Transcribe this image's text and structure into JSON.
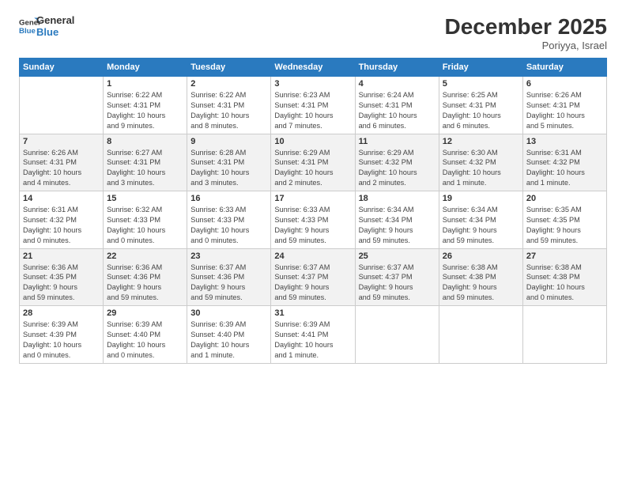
{
  "logo": {
    "line1": "General",
    "line2": "Blue"
  },
  "header": {
    "month": "December 2025",
    "location": "Poriyya, Israel"
  },
  "weekdays": [
    "Sunday",
    "Monday",
    "Tuesday",
    "Wednesday",
    "Thursday",
    "Friday",
    "Saturday"
  ],
  "weeks": [
    [
      {
        "day": "",
        "info": ""
      },
      {
        "day": "1",
        "info": "Sunrise: 6:22 AM\nSunset: 4:31 PM\nDaylight: 10 hours\nand 9 minutes."
      },
      {
        "day": "2",
        "info": "Sunrise: 6:22 AM\nSunset: 4:31 PM\nDaylight: 10 hours\nand 8 minutes."
      },
      {
        "day": "3",
        "info": "Sunrise: 6:23 AM\nSunset: 4:31 PM\nDaylight: 10 hours\nand 7 minutes."
      },
      {
        "day": "4",
        "info": "Sunrise: 6:24 AM\nSunset: 4:31 PM\nDaylight: 10 hours\nand 6 minutes."
      },
      {
        "day": "5",
        "info": "Sunrise: 6:25 AM\nSunset: 4:31 PM\nDaylight: 10 hours\nand 6 minutes."
      },
      {
        "day": "6",
        "info": "Sunrise: 6:26 AM\nSunset: 4:31 PM\nDaylight: 10 hours\nand 5 minutes."
      }
    ],
    [
      {
        "day": "7",
        "info": "Sunrise: 6:26 AM\nSunset: 4:31 PM\nDaylight: 10 hours\nand 4 minutes."
      },
      {
        "day": "8",
        "info": "Sunrise: 6:27 AM\nSunset: 4:31 PM\nDaylight: 10 hours\nand 3 minutes."
      },
      {
        "day": "9",
        "info": "Sunrise: 6:28 AM\nSunset: 4:31 PM\nDaylight: 10 hours\nand 3 minutes."
      },
      {
        "day": "10",
        "info": "Sunrise: 6:29 AM\nSunset: 4:31 PM\nDaylight: 10 hours\nand 2 minutes."
      },
      {
        "day": "11",
        "info": "Sunrise: 6:29 AM\nSunset: 4:32 PM\nDaylight: 10 hours\nand 2 minutes."
      },
      {
        "day": "12",
        "info": "Sunrise: 6:30 AM\nSunset: 4:32 PM\nDaylight: 10 hours\nand 1 minute."
      },
      {
        "day": "13",
        "info": "Sunrise: 6:31 AM\nSunset: 4:32 PM\nDaylight: 10 hours\nand 1 minute."
      }
    ],
    [
      {
        "day": "14",
        "info": "Sunrise: 6:31 AM\nSunset: 4:32 PM\nDaylight: 10 hours\nand 0 minutes."
      },
      {
        "day": "15",
        "info": "Sunrise: 6:32 AM\nSunset: 4:33 PM\nDaylight: 10 hours\nand 0 minutes."
      },
      {
        "day": "16",
        "info": "Sunrise: 6:33 AM\nSunset: 4:33 PM\nDaylight: 10 hours\nand 0 minutes."
      },
      {
        "day": "17",
        "info": "Sunrise: 6:33 AM\nSunset: 4:33 PM\nDaylight: 9 hours\nand 59 minutes."
      },
      {
        "day": "18",
        "info": "Sunrise: 6:34 AM\nSunset: 4:34 PM\nDaylight: 9 hours\nand 59 minutes."
      },
      {
        "day": "19",
        "info": "Sunrise: 6:34 AM\nSunset: 4:34 PM\nDaylight: 9 hours\nand 59 minutes."
      },
      {
        "day": "20",
        "info": "Sunrise: 6:35 AM\nSunset: 4:35 PM\nDaylight: 9 hours\nand 59 minutes."
      }
    ],
    [
      {
        "day": "21",
        "info": "Sunrise: 6:36 AM\nSunset: 4:35 PM\nDaylight: 9 hours\nand 59 minutes."
      },
      {
        "day": "22",
        "info": "Sunrise: 6:36 AM\nSunset: 4:36 PM\nDaylight: 9 hours\nand 59 minutes."
      },
      {
        "day": "23",
        "info": "Sunrise: 6:37 AM\nSunset: 4:36 PM\nDaylight: 9 hours\nand 59 minutes."
      },
      {
        "day": "24",
        "info": "Sunrise: 6:37 AM\nSunset: 4:37 PM\nDaylight: 9 hours\nand 59 minutes."
      },
      {
        "day": "25",
        "info": "Sunrise: 6:37 AM\nSunset: 4:37 PM\nDaylight: 9 hours\nand 59 minutes."
      },
      {
        "day": "26",
        "info": "Sunrise: 6:38 AM\nSunset: 4:38 PM\nDaylight: 9 hours\nand 59 minutes."
      },
      {
        "day": "27",
        "info": "Sunrise: 6:38 AM\nSunset: 4:38 PM\nDaylight: 10 hours\nand 0 minutes."
      }
    ],
    [
      {
        "day": "28",
        "info": "Sunrise: 6:39 AM\nSunset: 4:39 PM\nDaylight: 10 hours\nand 0 minutes."
      },
      {
        "day": "29",
        "info": "Sunrise: 6:39 AM\nSunset: 4:40 PM\nDaylight: 10 hours\nand 0 minutes."
      },
      {
        "day": "30",
        "info": "Sunrise: 6:39 AM\nSunset: 4:40 PM\nDaylight: 10 hours\nand 1 minute."
      },
      {
        "day": "31",
        "info": "Sunrise: 6:39 AM\nSunset: 4:41 PM\nDaylight: 10 hours\nand 1 minute."
      },
      {
        "day": "",
        "info": ""
      },
      {
        "day": "",
        "info": ""
      },
      {
        "day": "",
        "info": ""
      }
    ]
  ]
}
